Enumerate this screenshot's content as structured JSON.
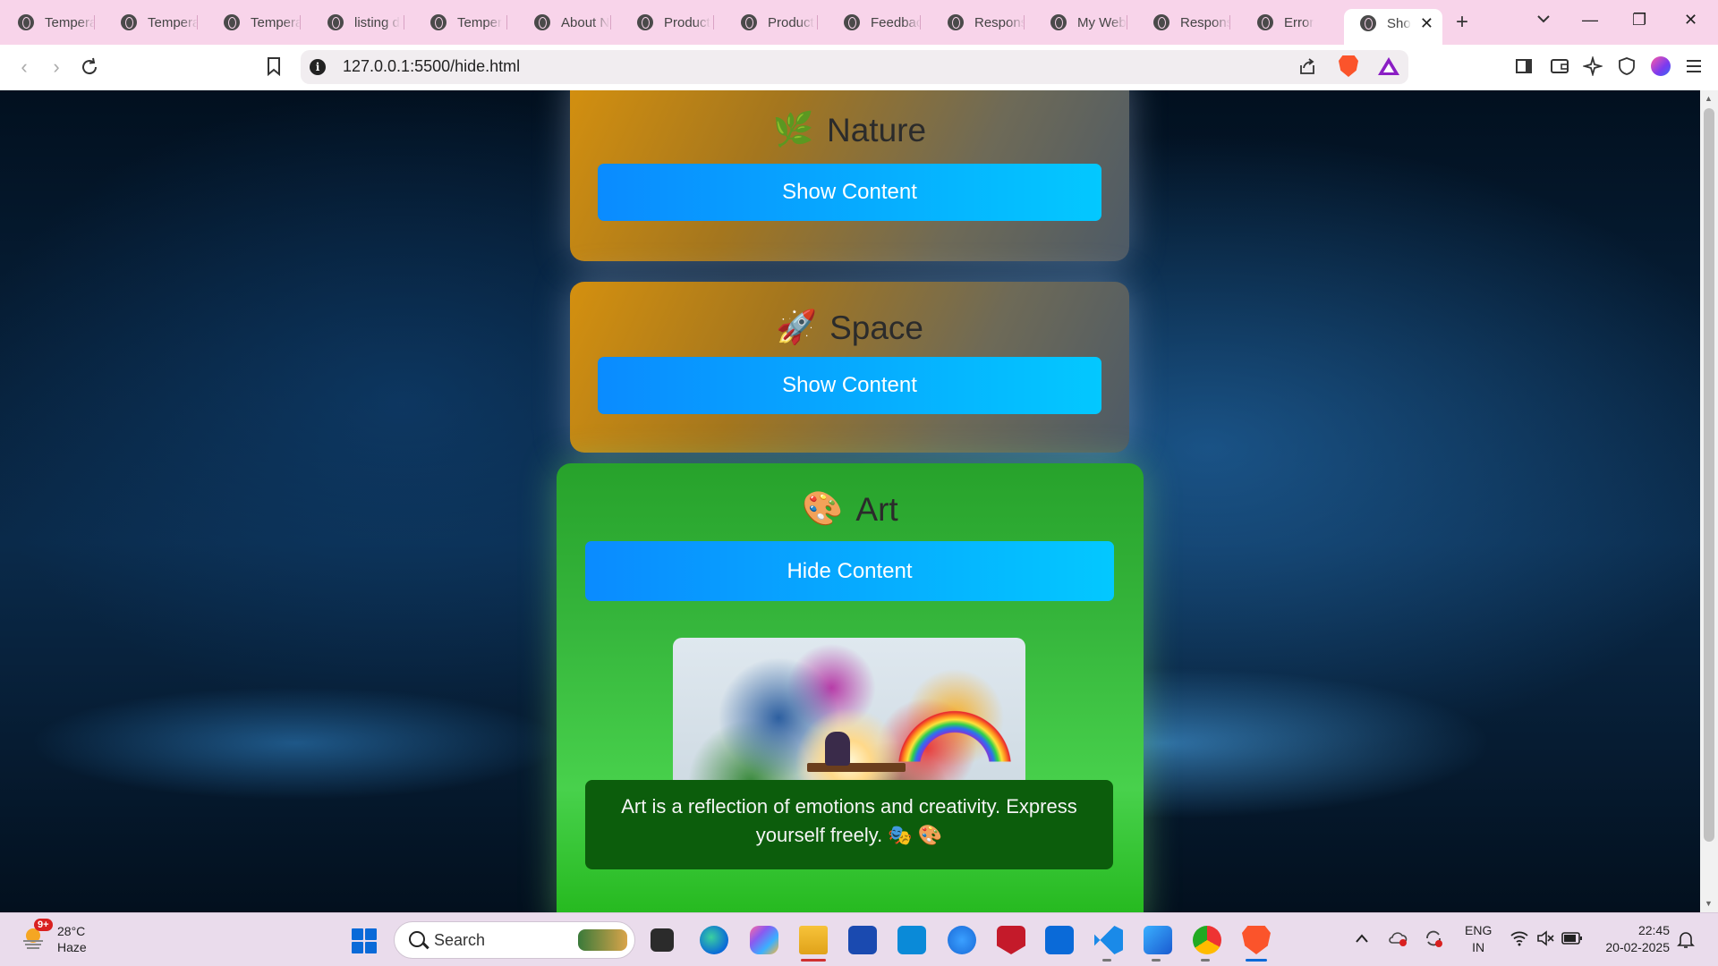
{
  "browser": {
    "tabs": [
      {
        "label": "Tempera"
      },
      {
        "label": "Tempera"
      },
      {
        "label": "Tempera"
      },
      {
        "label": "listing d"
      },
      {
        "label": "Temper"
      },
      {
        "label": "About N"
      },
      {
        "label": "Product"
      },
      {
        "label": "Product"
      },
      {
        "label": "Feedbac"
      },
      {
        "label": "Respons"
      },
      {
        "label": "My Web"
      },
      {
        "label": "Respons"
      },
      {
        "label": "Error"
      },
      {
        "label": "Sho"
      }
    ],
    "active_tab_index": 13,
    "new_tab": "+",
    "window_controls": {
      "minimize": "—",
      "restore": "❐",
      "close": "✕"
    },
    "url": "127.0.0.1:5500/hide.html"
  },
  "page": {
    "cards": [
      {
        "emoji": "🌿",
        "title": "Nature",
        "button": "Show Content",
        "expanded": false
      },
      {
        "emoji": "🚀",
        "title": "Space",
        "button": "Show Content",
        "expanded": false
      },
      {
        "emoji": "🎨",
        "title": "Art",
        "button": "Hide Content",
        "expanded": true,
        "description": "Art is a reflection of emotions and creativity. Express yourself freely. 🎭 🎨"
      }
    ]
  },
  "taskbar": {
    "weather": {
      "temperature": "28°C",
      "condition": "Haze",
      "badge": "9+"
    },
    "search_placeholder": "Search",
    "language": {
      "line1": "ENG",
      "line2": "IN"
    },
    "time": "22:45",
    "date": "20-02-2025"
  },
  "colors": {
    "tabstrip": "#f8d4ea",
    "button_gradient_start": "#0a8bff",
    "button_gradient_end": "#03c8ff",
    "art_card": "#36b63c",
    "caption_bg": "#0c5d0c"
  }
}
